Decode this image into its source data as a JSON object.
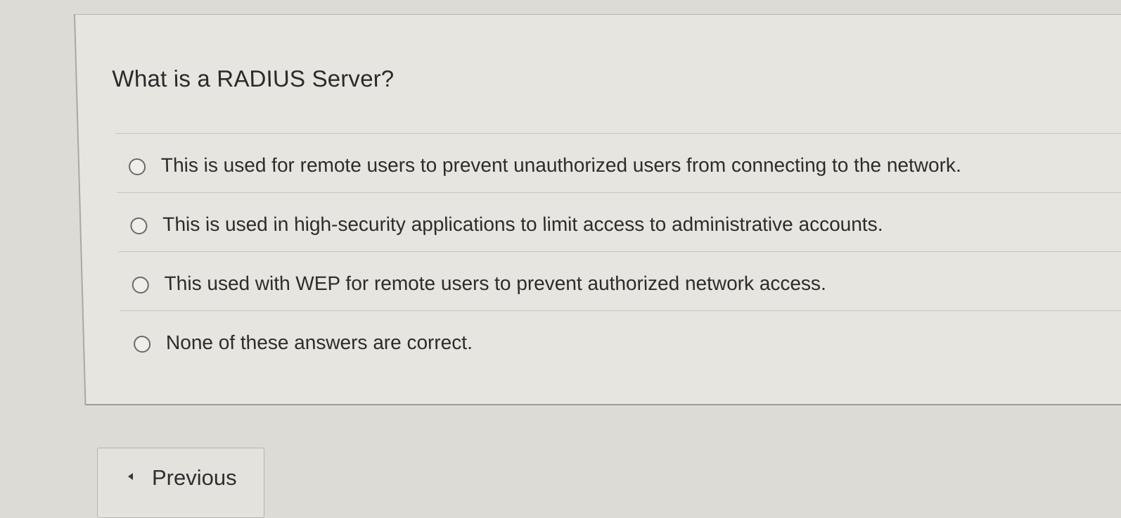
{
  "question": {
    "title": "What is a RADIUS Server?",
    "options": [
      {
        "label": "This is used for remote users to prevent unauthorized users from connecting to the network.",
        "selected": false
      },
      {
        "label": "This is used in high-security applications to limit access to administrative accounts.",
        "selected": false
      },
      {
        "label": "This used with WEP for remote users to prevent authorized network access.",
        "selected": false
      },
      {
        "label": "None of these answers are correct.",
        "selected": false
      }
    ]
  },
  "navigation": {
    "previous_label": "Previous",
    "previous_icon": "chevron-left-icon"
  }
}
